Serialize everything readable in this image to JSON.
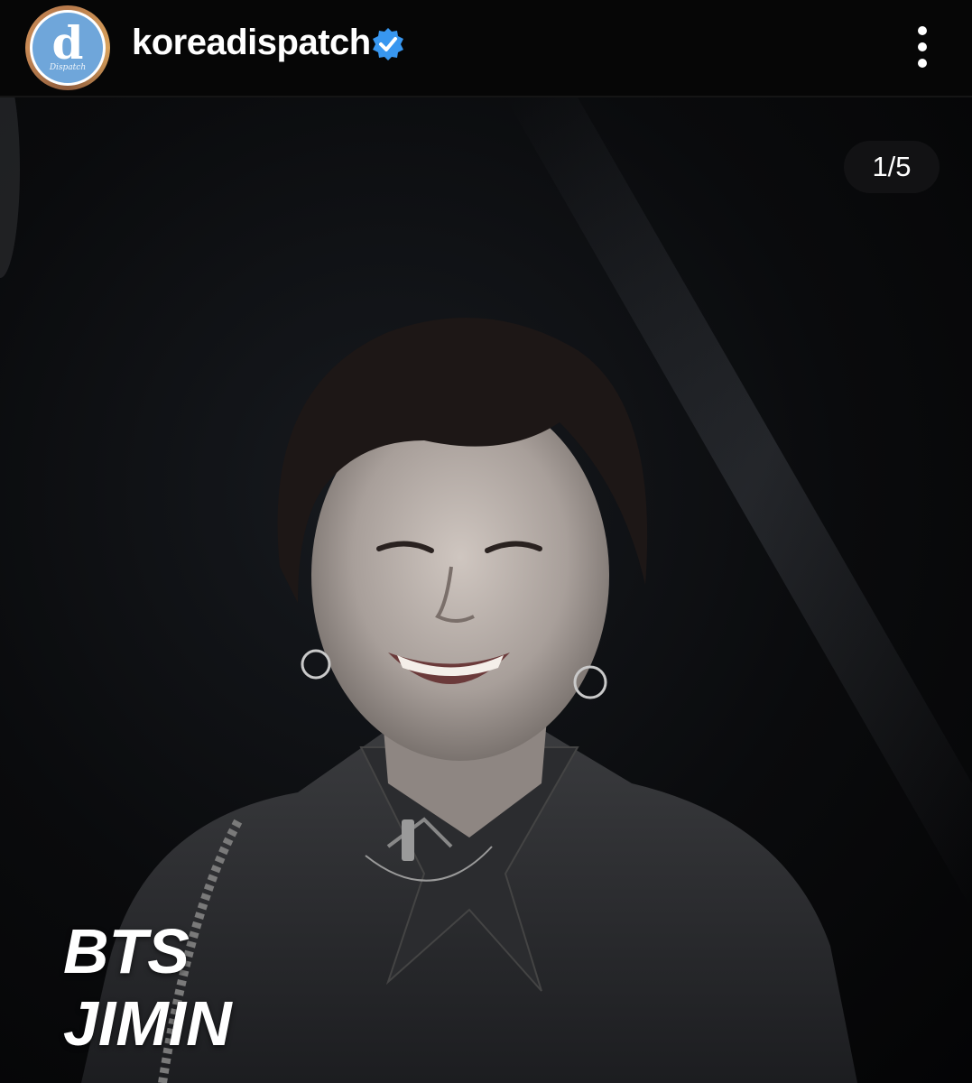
{
  "post": {
    "account": {
      "avatar_letter": "d",
      "avatar_sub": "Dispatch",
      "username": "koreadispatch",
      "verified_icon": "verified-badge-icon",
      "verified_color": "#3897f0"
    },
    "menu_icon": "more-vertical-icon",
    "carousel": {
      "counter": "1/5"
    },
    "caption_lines": [
      "BTS",
      "JIMIN"
    ],
    "photo_subject": "person-smiling-dark-jacket"
  }
}
